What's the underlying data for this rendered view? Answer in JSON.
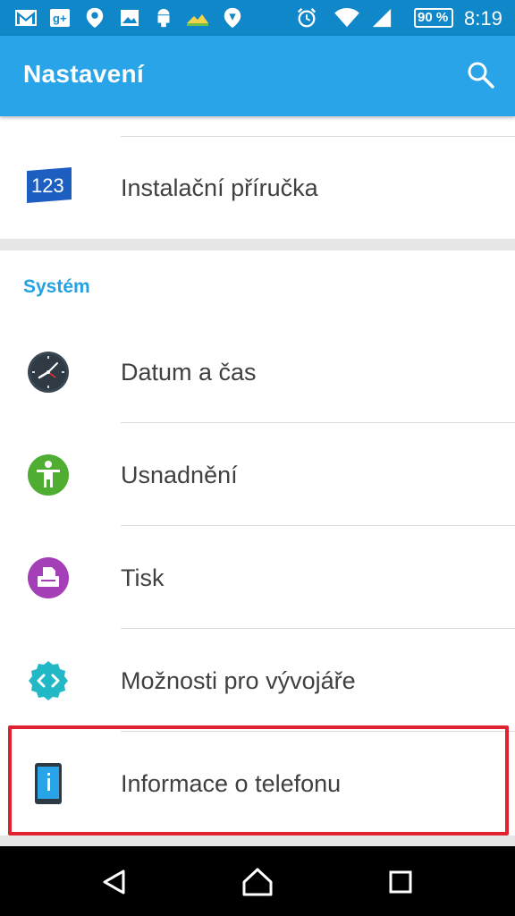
{
  "status_bar": {
    "battery": "90 %",
    "time": "8:19",
    "icons": [
      "gmail-icon",
      "google-plus-icon",
      "location-pin-icon",
      "gallery-icon",
      "android-download-icon",
      "weather-icon",
      "maps-icon",
      "alarm-icon",
      "wifi-icon",
      "signal-icon",
      "battery-icon"
    ]
  },
  "app_bar": {
    "title": "Nastavení",
    "search_icon": "search-icon"
  },
  "items_top": [
    {
      "label": "Instalační příručka",
      "icon": "setup-guide-123-icon"
    }
  ],
  "section": {
    "title": "Systém"
  },
  "items": [
    {
      "label": "Datum a čas",
      "icon": "clock-icon"
    },
    {
      "label": "Usnadnění",
      "icon": "accessibility-icon"
    },
    {
      "label": "Tisk",
      "icon": "printer-icon"
    },
    {
      "label": "Možnosti pro vývojáře",
      "icon": "developer-options-icon"
    },
    {
      "label": "Informace o telefonu",
      "icon": "phone-info-icon"
    }
  ],
  "nav_bar": {
    "icons": [
      "back-icon",
      "home-icon",
      "recents-icon"
    ]
  },
  "colors": {
    "status_bar": "#0f87c8",
    "app_bar": "#2aa4e8",
    "section_title": "#23a2e3",
    "highlight": "#e0222e"
  }
}
